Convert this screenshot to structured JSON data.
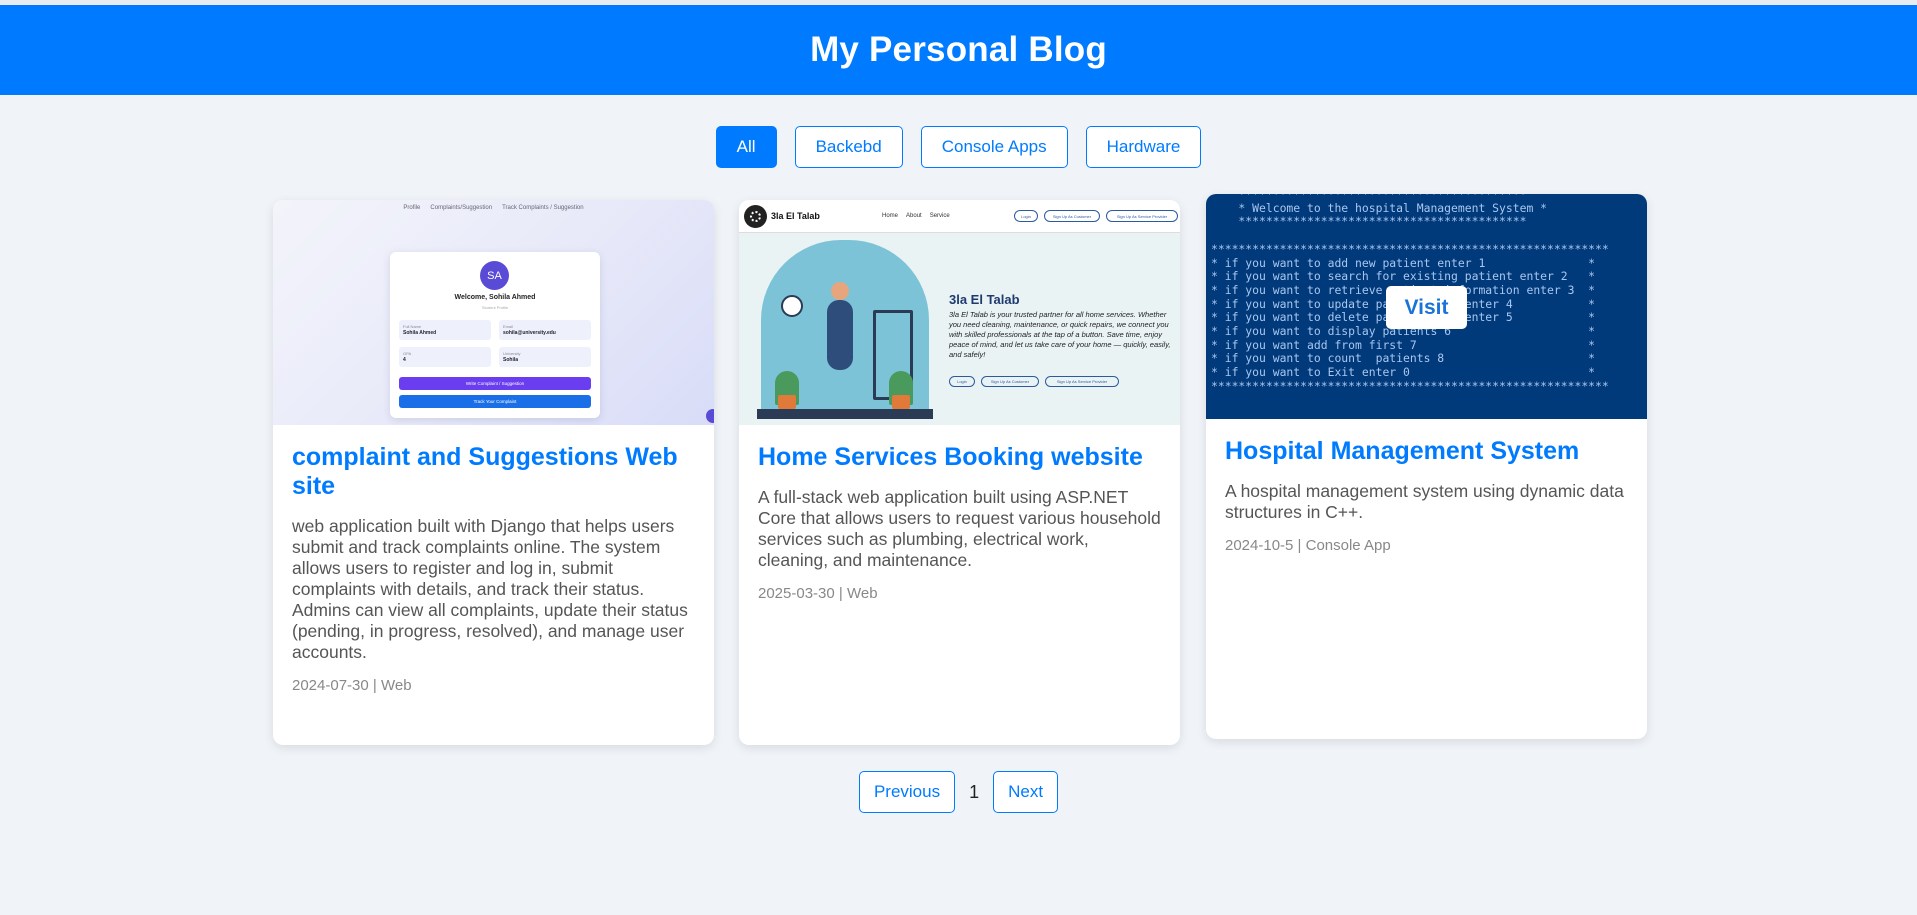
{
  "header": {
    "title": "My Personal Blog"
  },
  "filters": [
    {
      "label": "All",
      "active": true
    },
    {
      "label": "Backebd",
      "active": false
    },
    {
      "label": "Console Apps",
      "active": false
    },
    {
      "label": "Hardware",
      "active": false
    }
  ],
  "posts": [
    {
      "title": "complaint and Suggestions Web site",
      "description": "web application built with Django that helps users submit and track complaints online. The system allows users to register and log in, submit complaints with details, and track their status. Admins can view all complaints, update their status (pending, in progress, resolved), and manage user accounts.",
      "meta": "2024-07-30 | Web",
      "thumbnail": {
        "nav": [
          "Profile",
          "Complaints/Suggestion",
          "Track Complaints / Suggestion"
        ],
        "avatar": "SA",
        "welcome": "Welcome, Sohila Ahmed",
        "subtitle": "Student Profile",
        "fields": [
          {
            "label": "Full Name",
            "value": "Sohila Ahmed"
          },
          {
            "label": "Email",
            "value": "sohila@university.edu"
          },
          {
            "label": "GPA",
            "value": "4"
          },
          {
            "label": "University",
            "value": "Sohila"
          }
        ],
        "primary_action": "Write Complaint / Suggestion",
        "secondary_action": "Track Your Complaint"
      }
    },
    {
      "title": "Home Services Booking website",
      "description": "A full-stack web application built using ASP.NET Core that allows users to request various household services such as plumbing, electrical work, cleaning, and maintenance.",
      "meta": "2025-03-30 | Web",
      "thumbnail": {
        "brand": "3la El Talab",
        "nav": [
          "Home",
          "About",
          "Service"
        ],
        "buttons": [
          "Login",
          "Sign Up As Customer",
          "Sign Up As Service Provider"
        ],
        "heading": "3la El Talab",
        "blurb": "3la El Talab is your trusted partner for all home services. Whether you need cleaning, maintenance, or quick repairs, we connect you with skilled professionals at the tap of a button. Save time, enjoy peace of mind, and let us take care of your home — quickly, easily, and safely!",
        "cta": [
          "Login",
          "Sign Up As Customer",
          "Sign Up As Service Provider"
        ]
      }
    },
    {
      "title": "Hospital Management System",
      "description": "A hospital management system using dynamic data structures in C++.",
      "meta": "2024-10-5 | Console App",
      "thumbnail": {
        "console_lines": [
          "    ******************************************",
          "    * Welcome to the hospital Management System *",
          "    ******************************************",
          "",
          "**********************************************************",
          "* if you want to add new patient enter 1               *",
          "* if you want to search for existing patient enter 2   *",
          "* if you want to retrieve patient information enter 3  *",
          "* if you want to update patient data enter 4           *",
          "* if you want to delete patient data enter 5           *",
          "* if you want to display patients 6                    *",
          "* if you want add from first 7                         *",
          "* if you want to count  patients 8                     *",
          "* if you want to Exit enter 0                          *",
          "**********************************************************"
        ],
        "overlay_button": "Visit"
      }
    }
  ],
  "pagination": {
    "previous": "Previous",
    "page": "1",
    "next": "Next"
  },
  "colors": {
    "primary": "#007bff",
    "background": "#f0f4f8",
    "console": "#003a7a"
  }
}
